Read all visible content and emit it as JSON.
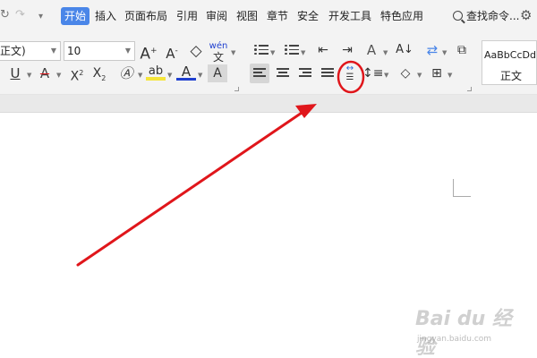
{
  "menubar": {
    "tabs": [
      "开始",
      "插入",
      "页面布局",
      "引用",
      "审阅",
      "视图",
      "章节",
      "安全",
      "开发工具",
      "特色应用"
    ],
    "active_tab": "开始",
    "search_label": "查找命令..."
  },
  "ribbon": {
    "font_name": "正文)",
    "font_size": "10",
    "phonetic_glyph": "wén"
  },
  "styles": {
    "sample": "AaBbCcDd",
    "name": "正文"
  },
  "watermark": {
    "brand": "Bai du 经验",
    "url": "jingyan.baidu.com"
  },
  "colors": {
    "accent": "#4a86e8",
    "annotation": "#e0161b",
    "highlight": "#f5e53a",
    "font_color": "#1f3fcf"
  }
}
